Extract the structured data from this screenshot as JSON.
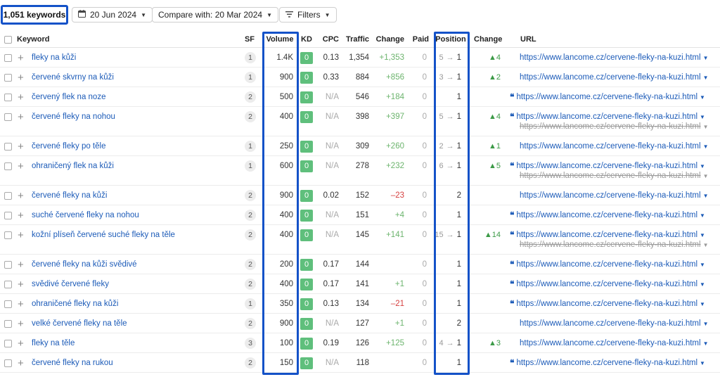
{
  "toolbar": {
    "keywords_count": "1,051 keywords",
    "date_label": "20 Jun 2024",
    "compare_label": "Compare with: 20 Mar 2024",
    "filters_label": "Filters"
  },
  "table": {
    "headers": {
      "keyword": "Keyword",
      "sf": "SF",
      "volume": "Volume",
      "kd": "KD",
      "cpc": "CPC",
      "traffic": "Traffic",
      "change": "Change",
      "paid": "Paid",
      "position": "Position",
      "pos_change": "Change",
      "url": "URL"
    },
    "rows": [
      {
        "keyword": "fleky na kůži",
        "sf": "1",
        "volume": "1.4K",
        "kd": "0",
        "cpc": "0.13",
        "traffic": "1,354",
        "change": "+1,353",
        "change_type": "pos",
        "paid": "0",
        "pos_prev": "5",
        "pos": "1",
        "pos_change": "▲4",
        "url_icon": false,
        "url": "https://www.lancome.cz/cervene-fleky-na-kuzi.html",
        "url_old": null
      },
      {
        "keyword": "červené skvrny na kůži",
        "sf": "1",
        "volume": "900",
        "kd": "0",
        "cpc": "0.33",
        "traffic": "884",
        "change": "+856",
        "change_type": "pos",
        "paid": "0",
        "pos_prev": "3",
        "pos": "1",
        "pos_change": "▲2",
        "url_icon": false,
        "url": "https://www.lancome.cz/cervene-fleky-na-kuzi.html",
        "url_old": null
      },
      {
        "keyword": "červený flek na noze",
        "sf": "2",
        "volume": "500",
        "kd": "0",
        "cpc": "N/A",
        "traffic": "546",
        "change": "+184",
        "change_type": "pos",
        "paid": "0",
        "pos_prev": "",
        "pos": "1",
        "pos_change": "",
        "url_icon": true,
        "url": "https://www.lancome.cz/cervene-fleky-na-kuzi.html",
        "url_old": null
      },
      {
        "keyword": "červené fleky na nohou",
        "sf": "2",
        "volume": "400",
        "kd": "0",
        "cpc": "N/A",
        "traffic": "398",
        "change": "+397",
        "change_type": "pos",
        "paid": "0",
        "pos_prev": "5",
        "pos": "1",
        "pos_change": "▲4",
        "url_icon": true,
        "url": "https://www.lancome.cz/cervene-fleky-na-kuzi.html",
        "url_old": "https://www.lancome.cz/cervene-fleky-na-kuzi.html"
      },
      {
        "keyword": "červené fleky po těle",
        "sf": "1",
        "volume": "250",
        "kd": "0",
        "cpc": "N/A",
        "traffic": "309",
        "change": "+260",
        "change_type": "pos",
        "paid": "0",
        "pos_prev": "2",
        "pos": "1",
        "pos_change": "▲1",
        "url_icon": false,
        "url": "https://www.lancome.cz/cervene-fleky-na-kuzi.html",
        "url_old": null
      },
      {
        "keyword": "ohraničený flek na kůži",
        "sf": "1",
        "volume": "600",
        "kd": "0",
        "cpc": "N/A",
        "traffic": "278",
        "change": "+232",
        "change_type": "pos",
        "paid": "0",
        "pos_prev": "6",
        "pos": "1",
        "pos_change": "▲5",
        "url_icon": true,
        "url": "https://www.lancome.cz/cervene-fleky-na-kuzi.html",
        "url_old": "https://www.lancome.cz/cervene-fleky-na-kuzi.html"
      },
      {
        "keyword": "červené fleky na kůži",
        "sf": "2",
        "volume": "900",
        "kd": "0",
        "cpc": "0.02",
        "traffic": "152",
        "change": "–23",
        "change_type": "neg",
        "paid": "0",
        "pos_prev": "",
        "pos": "2",
        "pos_change": "",
        "url_icon": false,
        "url": "https://www.lancome.cz/cervene-fleky-na-kuzi.html",
        "url_old": null
      },
      {
        "keyword": "suché červené fleky na nohou",
        "sf": "2",
        "volume": "400",
        "kd": "0",
        "cpc": "N/A",
        "traffic": "151",
        "change": "+4",
        "change_type": "pos",
        "paid": "0",
        "pos_prev": "",
        "pos": "1",
        "pos_change": "",
        "url_icon": true,
        "url": "https://www.lancome.cz/cervene-fleky-na-kuzi.html",
        "url_old": null
      },
      {
        "keyword": "kožní plíseň červené suché fleky na těle",
        "sf": "2",
        "volume": "400",
        "kd": "0",
        "cpc": "N/A",
        "traffic": "145",
        "change": "+141",
        "change_type": "pos",
        "paid": "0",
        "pos_prev": "15",
        "pos": "1",
        "pos_change": "▲14",
        "url_icon": true,
        "url": "https://www.lancome.cz/cervene-fleky-na-kuzi.html",
        "url_old": "https://www.lancome.cz/cervene-fleky-na-kuzi.html"
      },
      {
        "keyword": "červené fleky na kůži svědivé",
        "sf": "2",
        "volume": "200",
        "kd": "0",
        "cpc": "0.17",
        "traffic": "144",
        "change": "",
        "change_type": "pos",
        "paid": "0",
        "pos_prev": "",
        "pos": "1",
        "pos_change": "",
        "url_icon": true,
        "url": "https://www.lancome.cz/cervene-fleky-na-kuzi.html",
        "url_old": null
      },
      {
        "keyword": "svědivé červené fleky",
        "sf": "2",
        "volume": "400",
        "kd": "0",
        "cpc": "0.17",
        "traffic": "141",
        "change": "+1",
        "change_type": "pos",
        "paid": "0",
        "pos_prev": "",
        "pos": "1",
        "pos_change": "",
        "url_icon": true,
        "url": "https://www.lancome.cz/cervene-fleky-na-kuzi.html",
        "url_old": null
      },
      {
        "keyword": "ohraničené fleky na kůži",
        "sf": "1",
        "volume": "350",
        "kd": "0",
        "cpc": "0.13",
        "traffic": "134",
        "change": "–21",
        "change_type": "neg",
        "paid": "0",
        "pos_prev": "",
        "pos": "1",
        "pos_change": "",
        "url_icon": true,
        "url": "https://www.lancome.cz/cervene-fleky-na-kuzi.html",
        "url_old": null
      },
      {
        "keyword": "velké červené fleky na těle",
        "sf": "2",
        "volume": "900",
        "kd": "0",
        "cpc": "N/A",
        "traffic": "127",
        "change": "+1",
        "change_type": "pos",
        "paid": "0",
        "pos_prev": "",
        "pos": "2",
        "pos_change": "",
        "url_icon": false,
        "url": "https://www.lancome.cz/cervene-fleky-na-kuzi.html",
        "url_old": null
      },
      {
        "keyword": "fleky na těle",
        "sf": "3",
        "volume": "100",
        "kd": "0",
        "cpc": "0.19",
        "traffic": "126",
        "change": "+125",
        "change_type": "pos",
        "paid": "0",
        "pos_prev": "4",
        "pos": "1",
        "pos_change": "▲3",
        "url_icon": false,
        "url": "https://www.lancome.cz/cervene-fleky-na-kuzi.html",
        "url_old": null
      },
      {
        "keyword": "červené fleky na rukou",
        "sf": "2",
        "volume": "150",
        "kd": "0",
        "cpc": "N/A",
        "traffic": "118",
        "change": "",
        "change_type": "pos",
        "paid": "0",
        "pos_prev": "",
        "pos": "1",
        "pos_change": "",
        "url_icon": true,
        "url": "https://www.lancome.cz/cervene-fleky-na-kuzi.html",
        "url_old": null
      }
    ]
  },
  "icons": {
    "calendar": "calendar-icon",
    "filter": "filter-icon",
    "dropdown": "chevron-down-icon",
    "add": "plus-icon",
    "quote": "serp-feature-quote-icon"
  },
  "colors": {
    "highlight": "#1452c8",
    "link": "#1c5bb8",
    "kd_badge": "#5fbf7c",
    "positive": "#6cb46d",
    "negative": "#d64040"
  }
}
